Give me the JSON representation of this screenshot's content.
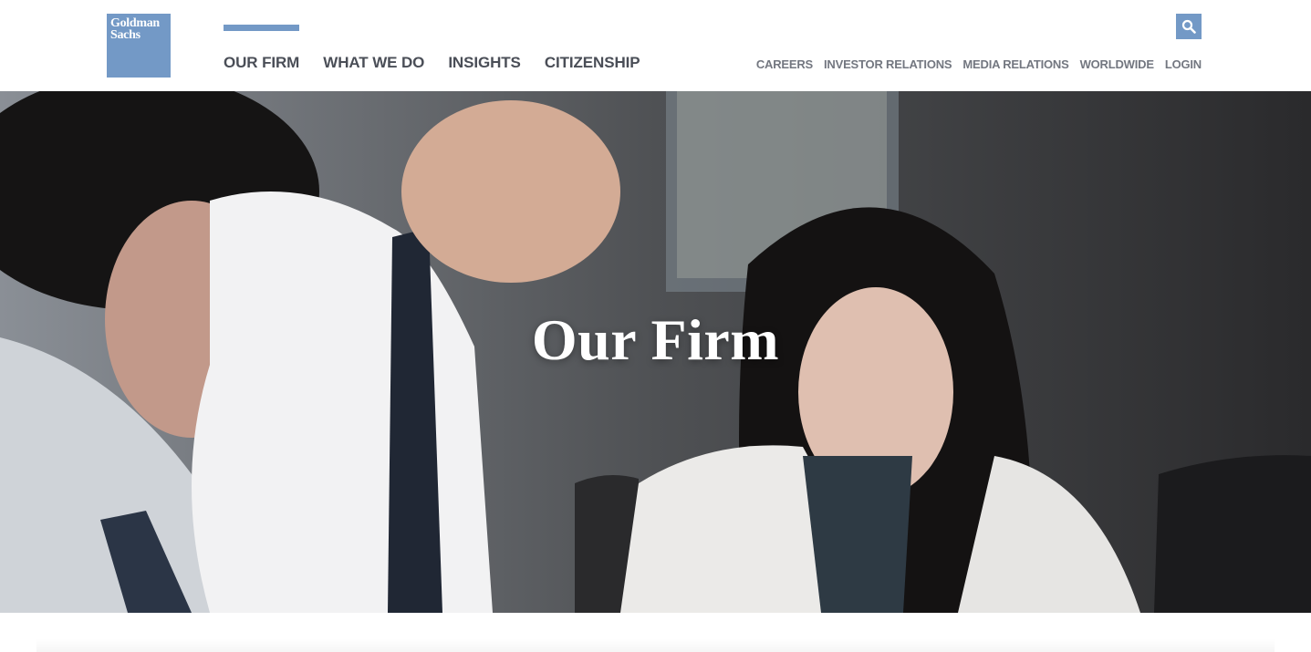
{
  "brand": {
    "logo_line1": "Goldman",
    "logo_line2": "Sachs",
    "accent": "#7399c6"
  },
  "primary_nav": [
    {
      "label": "OUR FIRM",
      "active": true
    },
    {
      "label": "WHAT WE DO",
      "active": false
    },
    {
      "label": "INSIGHTS",
      "active": false
    },
    {
      "label": "CITIZENSHIP",
      "active": false
    }
  ],
  "utility_nav": [
    {
      "label": "CAREERS"
    },
    {
      "label": "INVESTOR RELATIONS"
    },
    {
      "label": "MEDIA RELATIONS"
    },
    {
      "label": "WORLDWIDE"
    },
    {
      "label": "LOGIN"
    }
  ],
  "search": {
    "icon": "search-icon"
  },
  "hero": {
    "title": "Our Firm"
  }
}
